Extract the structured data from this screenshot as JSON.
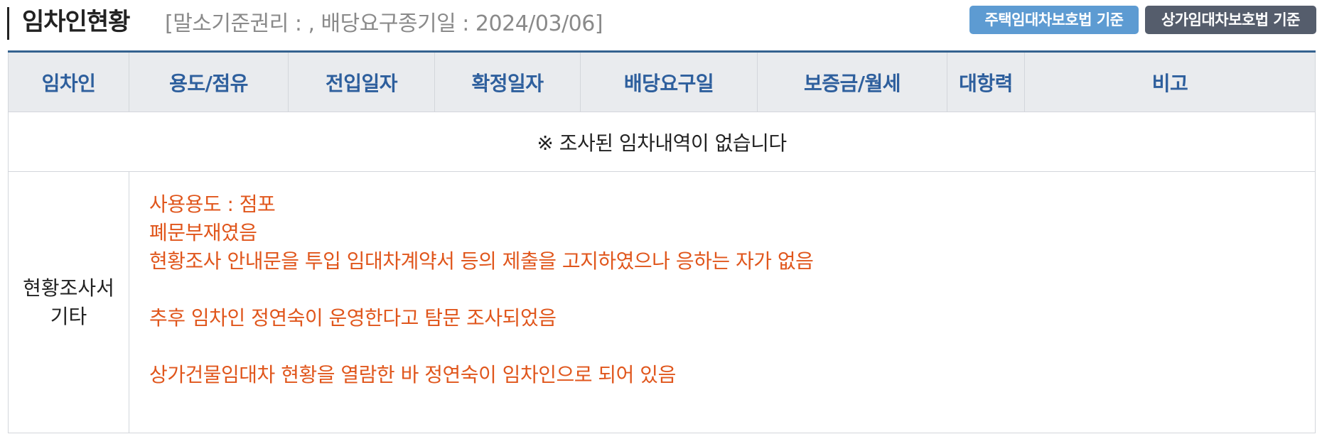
{
  "header": {
    "title": "임차인현황",
    "subtitle": "[말소기준권리 : , 배당요구종기일 : 2024/03/06]",
    "buttons": {
      "housing": "주택임대차보호법 기준",
      "commercial": "상가임대차보호법 기준"
    }
  },
  "table": {
    "columns": [
      "임차인",
      "용도/점유",
      "전입일자",
      "확정일자",
      "배당요구일",
      "보증금/월세",
      "대항력",
      "비고"
    ],
    "empty_message": "※ 조사된 임차내역이 없습니다",
    "note": {
      "label_lines": [
        "현황조사서",
        "기타"
      ],
      "lines": [
        "사용용도 : 점포",
        "폐문부재였음",
        "현황조사 안내문을 투입 임대차계약서 등의 제출을 고지하였으나 응하는 자가 없음",
        "",
        "추후 임차인 정연숙이 운영한다고 탐문 조사되었음",
        "",
        "상가건물임대차 현황을 열람한 바 정연숙이 임차인으로 되어 있음"
      ]
    }
  },
  "colors": {
    "header_text": "#2e5f9d",
    "header_border": "#34628f",
    "note_text": "#e0561c",
    "housing_button": "#5d9bd2",
    "commercial_button": "#555d6c"
  }
}
